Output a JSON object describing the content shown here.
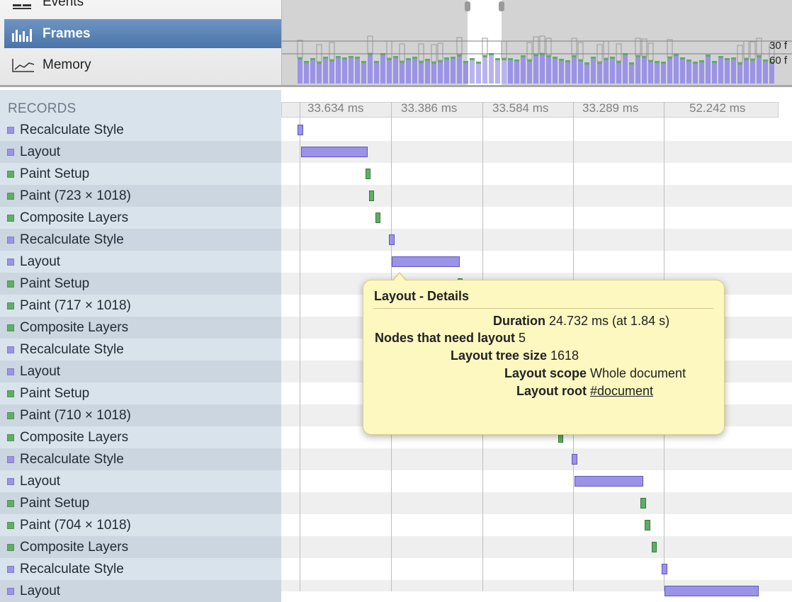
{
  "modes": {
    "events_label": "Events",
    "frames_label": "Frames",
    "memory_label": "Memory"
  },
  "overview": {
    "fps_30_label": "30 f",
    "fps_60_label": "60 f"
  },
  "records": {
    "header": "RECORDS",
    "frame_durations": [
      "33.634 ms",
      "33.386 ms",
      "33.584 ms",
      "33.289 ms",
      "52.242 ms"
    ],
    "items": [
      {
        "label": "Recalculate Style",
        "category": "rendering"
      },
      {
        "label": "Layout",
        "category": "rendering"
      },
      {
        "label": "Paint Setup",
        "category": "painting"
      },
      {
        "label": "Paint (723 × 1018)",
        "category": "painting"
      },
      {
        "label": "Composite Layers",
        "category": "painting"
      },
      {
        "label": "Recalculate Style",
        "category": "rendering"
      },
      {
        "label": "Layout",
        "category": "rendering"
      },
      {
        "label": "Paint Setup",
        "category": "painting"
      },
      {
        "label": "Paint (717 × 1018)",
        "category": "painting"
      },
      {
        "label": "Composite Layers",
        "category": "painting"
      },
      {
        "label": "Recalculate Style",
        "category": "rendering"
      },
      {
        "label": "Layout",
        "category": "rendering"
      },
      {
        "label": "Paint Setup",
        "category": "painting"
      },
      {
        "label": "Paint (710 × 1018)",
        "category": "painting"
      },
      {
        "label": "Composite Layers",
        "category": "painting"
      },
      {
        "label": "Recalculate Style",
        "category": "rendering"
      },
      {
        "label": "Layout",
        "category": "rendering"
      },
      {
        "label": "Paint Setup",
        "category": "painting"
      },
      {
        "label": "Paint (704 × 1018)",
        "category": "painting"
      },
      {
        "label": "Composite Layers",
        "category": "painting"
      },
      {
        "label": "Recalculate Style",
        "category": "rendering"
      },
      {
        "label": "Layout",
        "category": "rendering"
      }
    ]
  },
  "colors": {
    "rendering": "#9b93e8",
    "painting": "#5fae64",
    "frames_selected": "#5a82b4",
    "popover_bg": "#fdf7c0"
  },
  "popover": {
    "title": "Layout - Details",
    "rows": [
      {
        "key": "Duration",
        "value": "24.732 ms (at 1.84 s)"
      },
      {
        "key": "Nodes that need layout",
        "value": "5"
      },
      {
        "key": "Layout tree size",
        "value": "1618"
      },
      {
        "key": "Layout scope",
        "value": "Whole document"
      },
      {
        "key": "Layout root",
        "value": "#document"
      }
    ]
  }
}
